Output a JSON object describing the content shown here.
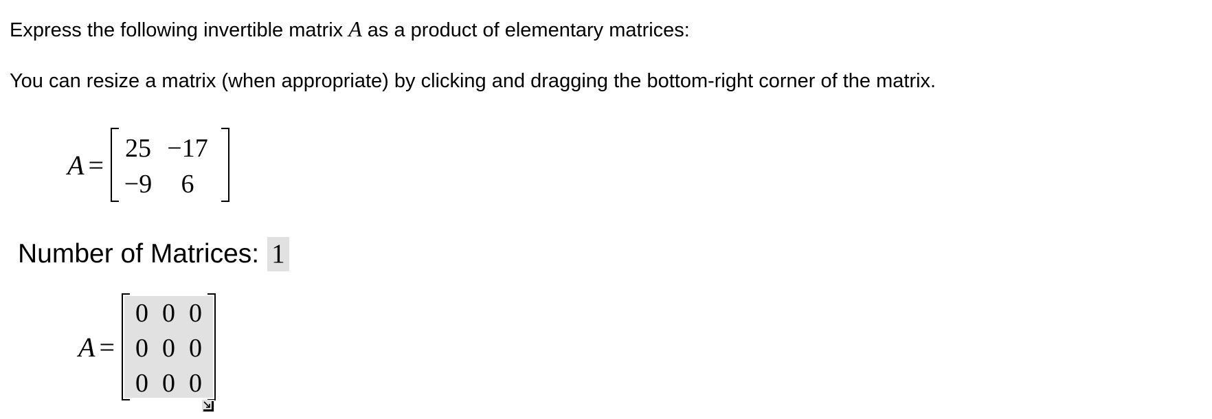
{
  "instructions": {
    "line1_before": "Express the following invertible matrix ",
    "line1_var": "A",
    "line1_after": " as a product of elementary matrices:",
    "line2": "You can resize a matrix (when appropriate) by clicking and dragging the bottom-right corner of the matrix."
  },
  "given_matrix": {
    "variable": "A",
    "equals": "=",
    "rows": [
      [
        "25",
        "−17"
      ],
      [
        "−9",
        "6"
      ]
    ]
  },
  "num_matrices": {
    "label": "Number of Matrices:",
    "value": "1"
  },
  "answer_matrix": {
    "variable": "A",
    "equals": "=",
    "rows": [
      [
        "0",
        "0",
        "0"
      ],
      [
        "0",
        "0",
        "0"
      ],
      [
        "0",
        "0",
        "0"
      ]
    ]
  },
  "icons": {
    "resize_handle": "resize-corner-icon"
  }
}
